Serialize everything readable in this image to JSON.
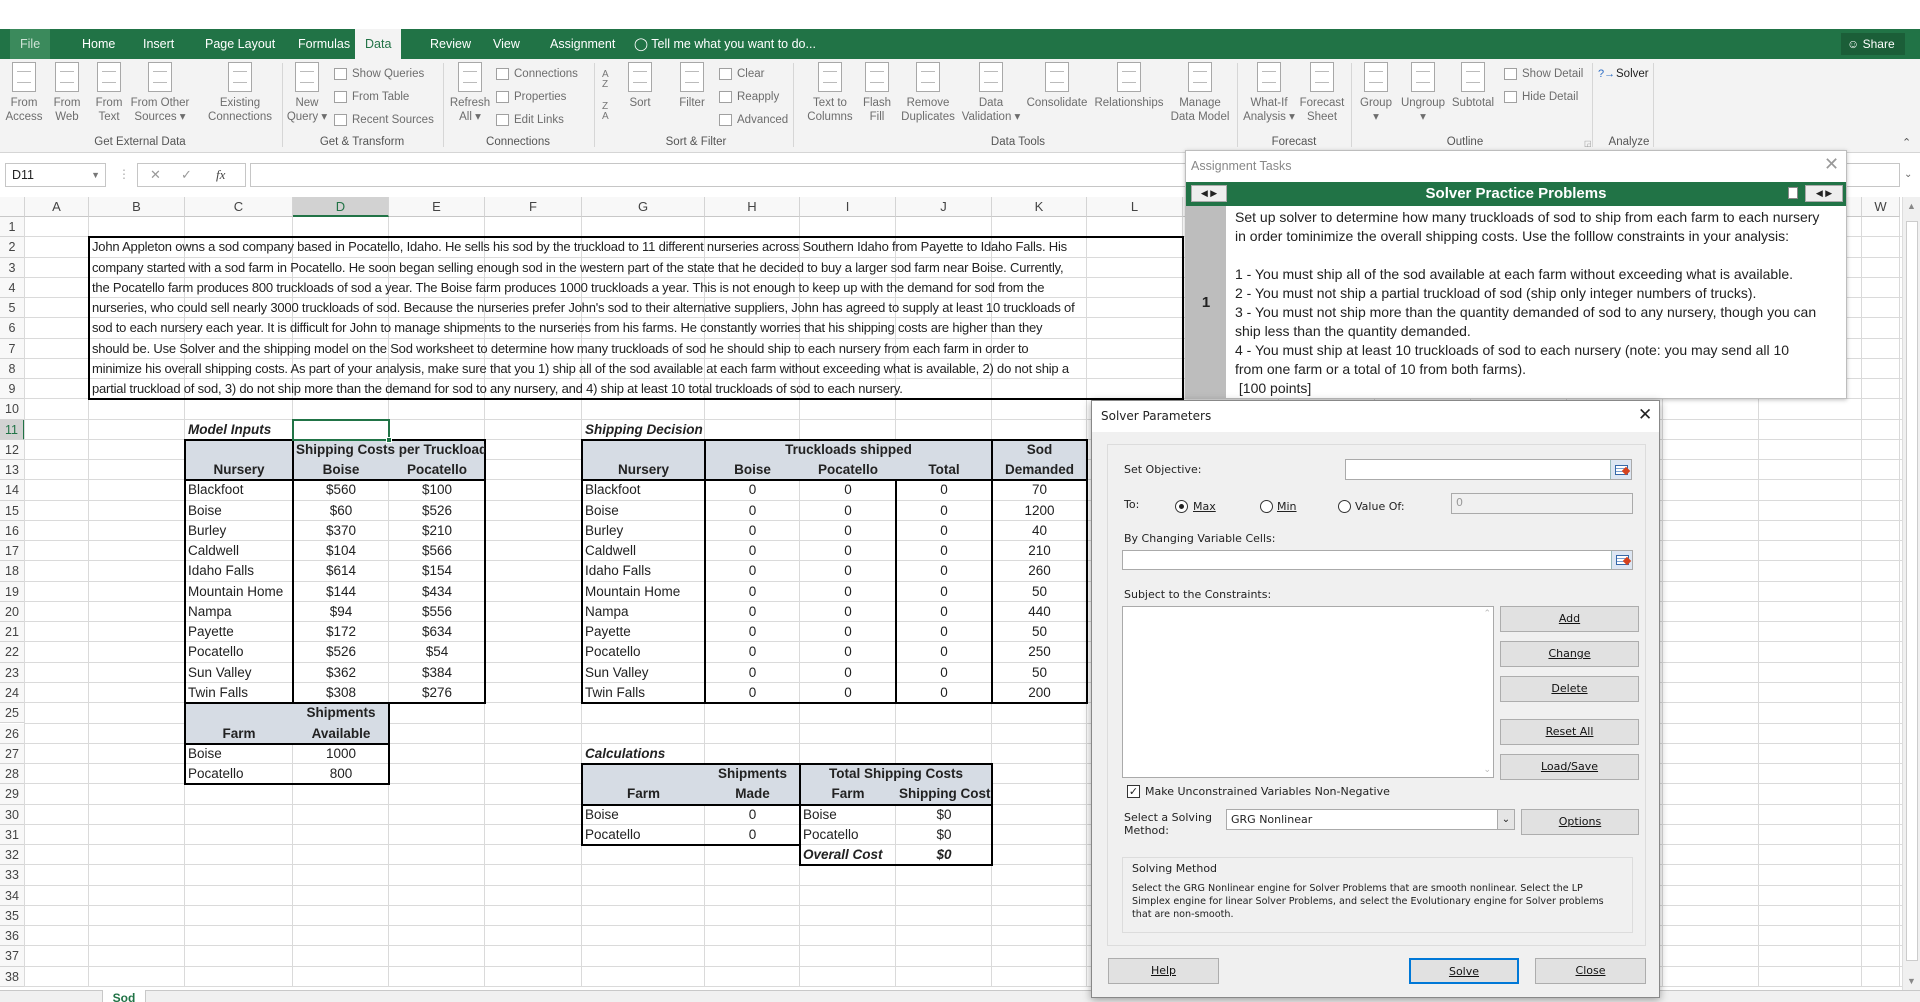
{
  "ribbon": {
    "tabs": [
      "File",
      "Home",
      "Insert",
      "Page Layout",
      "Formulas",
      "Data",
      "Review",
      "View",
      "Assignment"
    ],
    "active_tab": "Data",
    "tell_me": "Tell me what you want to do...",
    "share": "Share",
    "large_buttons": [
      {
        "label": "From\nAccess",
        "icon": "access-icon"
      },
      {
        "label": "From\nWeb",
        "icon": "web-icon"
      },
      {
        "label": "From\nText",
        "icon": "text-file-icon"
      },
      {
        "label": "From Other\nSources ▾",
        "icon": "other-sources-icon"
      },
      {
        "label": "Existing\nConnections",
        "icon": "existing-connections-icon"
      },
      {
        "label": "New\nQuery ▾",
        "icon": "new-query-icon"
      },
      {
        "label": "Refresh\nAll ▾",
        "icon": "refresh-icon"
      },
      {
        "label": "Sort",
        "icon": "sort-icon"
      },
      {
        "label": "Filter",
        "icon": "filter-icon"
      },
      {
        "label": "Text to\nColumns",
        "icon": "text-to-columns-icon"
      },
      {
        "label": "Flash\nFill",
        "icon": "flash-fill-icon"
      },
      {
        "label": "Remove\nDuplicates",
        "icon": "remove-duplicates-icon"
      },
      {
        "label": "Data\nValidation ▾",
        "icon": "data-validation-icon"
      },
      {
        "label": "Consolidate",
        "icon": "consolidate-icon"
      },
      {
        "label": "Relationships",
        "icon": "relationships-icon"
      },
      {
        "label": "Manage\nData Model",
        "icon": "data-model-icon"
      },
      {
        "label": "What-If\nAnalysis ▾",
        "icon": "what-if-icon"
      },
      {
        "label": "Forecast\nSheet",
        "icon": "forecast-icon"
      },
      {
        "label": "Group\n▾",
        "icon": "group-icon"
      },
      {
        "label": "Ungroup\n▾",
        "icon": "ungroup-icon"
      },
      {
        "label": "Subtotal",
        "icon": "subtotal-icon"
      }
    ],
    "small_buttons": [
      {
        "label": "Show Queries",
        "icon": "show-queries-icon"
      },
      {
        "label": "From Table",
        "icon": "from-table-icon"
      },
      {
        "label": "Recent Sources",
        "icon": "recent-sources-icon"
      },
      {
        "label": "Connections",
        "icon": "connections-icon"
      },
      {
        "label": "Properties",
        "icon": "properties-icon"
      },
      {
        "label": "Edit Links",
        "icon": "edit-links-icon"
      },
      {
        "label": "Clear",
        "icon": "clear-filter-icon"
      },
      {
        "label": "Reapply",
        "icon": "reapply-icon"
      },
      {
        "label": "Advanced",
        "icon": "advanced-filter-icon"
      },
      {
        "label": "Show Detail",
        "icon": "show-detail-icon"
      },
      {
        "label": "Hide Detail",
        "icon": "hide-detail-icon"
      },
      {
        "label": "Solver",
        "icon": "solver-icon"
      }
    ],
    "groups": [
      "Get External Data",
      "Get & Transform",
      "Connections",
      "Sort & Filter",
      "Data Tools",
      "Forecast",
      "Outline",
      "Analyze"
    ]
  },
  "formula_bar": {
    "name_box": "D11",
    "formula": "",
    "fx": "fx"
  },
  "sheet": {
    "columns": [
      "A",
      "B",
      "C",
      "D",
      "E",
      "F",
      "G",
      "H",
      "I",
      "J",
      "K",
      "L",
      "W"
    ],
    "selected_column": "D",
    "selected_row": 11,
    "row_numbers": [
      1,
      2,
      3,
      4,
      5,
      6,
      7,
      8,
      9,
      10,
      11,
      12,
      13,
      14,
      15,
      16,
      17,
      18,
      19,
      20,
      21,
      22,
      23,
      24,
      25,
      26,
      27,
      28,
      29,
      30,
      31,
      32,
      33,
      34,
      35,
      36,
      37,
      38
    ],
    "intro_lines": [
      "John Appleton owns a sod company based in Pocatello, Idaho. He sells his sod by the truckload to 11 different nurseries across Southern Idaho from Payette to Idaho Falls. His",
      "company started with a sod farm in Pocatello. He soon began selling enough sod in the western part of the state that he decided to buy a larger sod farm near Boise. Currently,",
      "the Pocatello farm produces 800 truckloads of sod a year. The Boise farm produces 1000 truckloads a year. This is not enough to keep up with the demand for sod from the",
      "nurseries, who could sell nearly 3000 truckloads of sod. Because the nurseries prefer John's sod to their alternative suppliers, John has agreed to supply at least 10 truckloads of",
      "sod to each nursery each year. It is difficult for John to manage shipments to the nurseries from his farms. He constantly worries that his shipping costs are higher than they",
      "should be. Use Solver and the shipping model on the Sod worksheet to determine how many truckloads of sod he should ship to each nursery from each farm in order to",
      "minimize his overall shipping costs. As part of your analysis, make sure that you 1) ship all of the sod available at each farm without exceeding what is available, 2) do not ship a",
      "partial truckload of sod, 3) do not ship more than the demand for sod to any nursery, and 4) ship at least 10 total truckloads of sod to each nursery."
    ],
    "model_inputs": {
      "label": "Model Inputs",
      "cost_table": {
        "group_header": "Shipping Costs per Truckload",
        "headers": [
          "Nursery",
          "Boise",
          "Pocatello"
        ],
        "rows": [
          [
            "Blackfoot",
            "$560",
            "$100"
          ],
          [
            "Boise",
            "$60",
            "$526"
          ],
          [
            "Burley",
            "$370",
            "$210"
          ],
          [
            "Caldwell",
            "$104",
            "$566"
          ],
          [
            "Idaho Falls",
            "$614",
            "$154"
          ],
          [
            "Mountain Home",
            "$144",
            "$434"
          ],
          [
            "Nampa",
            "$94",
            "$556"
          ],
          [
            "Payette",
            "$172",
            "$634"
          ],
          [
            "Pocatello",
            "$526",
            "$54"
          ],
          [
            "Sun Valley",
            "$362",
            "$384"
          ],
          [
            "Twin Falls",
            "$308",
            "$276"
          ]
        ]
      },
      "supply_table": {
        "group_header": "Shipments",
        "headers": [
          "Farm",
          "Available"
        ],
        "rows": [
          [
            "Boise",
            "1000"
          ],
          [
            "Pocatello",
            "800"
          ]
        ]
      }
    },
    "shipping_decision": {
      "label": "Shipping Decision",
      "group_header": "Truckloads shipped",
      "demand_header_top": "Sod",
      "headers": [
        "Nursery",
        "Boise",
        "Pocatello",
        "Total",
        "Demanded"
      ],
      "rows": [
        [
          "Blackfoot",
          "0",
          "0",
          "0",
          "70"
        ],
        [
          "Boise",
          "0",
          "0",
          "0",
          "1200"
        ],
        [
          "Burley",
          "0",
          "0",
          "0",
          "40"
        ],
        [
          "Caldwell",
          "0",
          "0",
          "0",
          "210"
        ],
        [
          "Idaho Falls",
          "0",
          "0",
          "0",
          "260"
        ],
        [
          "Mountain Home",
          "0",
          "0",
          "0",
          "50"
        ],
        [
          "Nampa",
          "0",
          "0",
          "0",
          "440"
        ],
        [
          "Payette",
          "0",
          "0",
          "0",
          "50"
        ],
        [
          "Pocatello",
          "0",
          "0",
          "0",
          "250"
        ],
        [
          "Sun Valley",
          "0",
          "0",
          "0",
          "50"
        ],
        [
          "Twin Falls",
          "0",
          "0",
          "0",
          "200"
        ]
      ]
    },
    "calculations": {
      "label": "Calculations",
      "shipments_table": {
        "group_header": "Shipments",
        "headers": [
          "Farm",
          "Made"
        ],
        "rows": [
          [
            "Boise",
            "0"
          ],
          [
            "Pocatello",
            "0"
          ]
        ]
      },
      "costs_table": {
        "group_header": "Total Shipping Costs",
        "headers": [
          "Farm",
          "Shipping Cost"
        ],
        "rows": [
          [
            "Boise",
            "$0"
          ],
          [
            "Pocatello",
            "$0"
          ]
        ],
        "total_label": "Overall Cost",
        "total_value": "$0"
      }
    },
    "sheet_tab": "Sod"
  },
  "assignment_pane": {
    "title": "Assignment Tasks",
    "header": "Solver Practice Problems",
    "task_number": "1",
    "task_lines": [
      "Set up solver to determine how many truckloads of sod to ship from each farm to each nursery",
      "in order tominimize the overall shipping costs. Use the folllow constraints in your analysis:",
      "",
      "1 - You must ship all of the sod available at each farm without exceeding what is available.",
      "2 - You must not ship a partial truckload of sod (ship only integer numbers of trucks).",
      "3 - You must not ship more than the quantity demanded of sod to any nursery, though you can",
      "ship less than the quantity demanded.",
      "4 - You must ship at least 10 truckloads of sod to each nursery (note: you may send all 10",
      "from one farm or a total of 10 from both farms).",
      " [100 points]"
    ]
  },
  "solver": {
    "title": "Solver Parameters",
    "set_objective_label": "Set Objective:",
    "set_objective_value": "",
    "to_label": "To:",
    "options": [
      "Max",
      "Min",
      "Value Of:"
    ],
    "selected_option": "Max",
    "value_of": "0",
    "changing_cells_label": "By Changing Variable Cells:",
    "changing_cells_value": "",
    "constraints_label": "Subject to the Constraints:",
    "constraints": [],
    "side_buttons": [
      "Add",
      "Change",
      "Delete",
      "Reset All",
      "Load/Save"
    ],
    "nonneg_label": "Make Unconstrained Variables Non-Negative",
    "nonneg_checked": true,
    "method_label": "Select a Solving\nMethod:",
    "method_value": "GRG Nonlinear",
    "options_button": "Options",
    "method_box_title": "Solving Method",
    "method_box_text": "Select the GRG Nonlinear engine for Solver Problems that are smooth nonlinear. Select the LP Simplex engine for linear Solver Problems, and select the Evolutionary engine for Solver problems that are non-smooth.",
    "help": "Help",
    "solve": "Solve",
    "close": "Close"
  }
}
